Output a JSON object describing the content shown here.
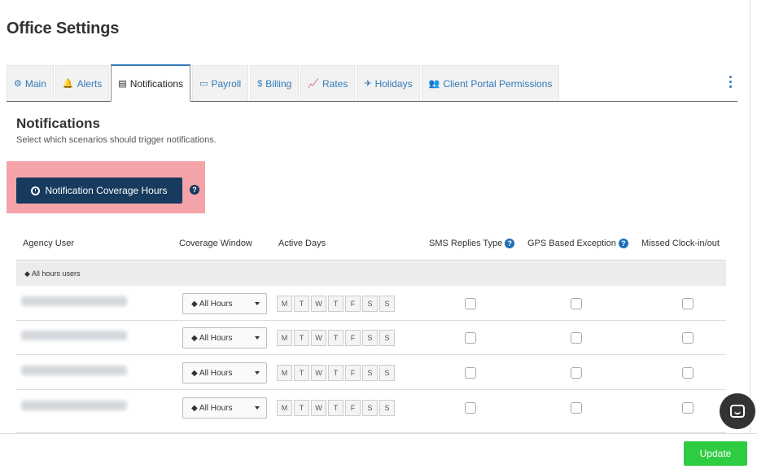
{
  "page": {
    "title": "Office Settings"
  },
  "tabs": [
    {
      "label": "Main",
      "icon": "gear-icon",
      "glyph": "⚙"
    },
    {
      "label": "Alerts",
      "icon": "bell-icon",
      "glyph": "🔔"
    },
    {
      "label": "Notifications",
      "icon": "file-icon",
      "glyph": "▤",
      "active": true
    },
    {
      "label": "Payroll",
      "icon": "payroll-icon",
      "glyph": "▭"
    },
    {
      "label": "Billing",
      "icon": "dollar-icon",
      "glyph": "$"
    },
    {
      "label": "Rates",
      "icon": "chart-icon",
      "glyph": "📈"
    },
    {
      "label": "Holidays",
      "icon": "plane-icon",
      "glyph": "✈"
    },
    {
      "label": "Client Portal Permissions",
      "icon": "users-icon",
      "glyph": "👥"
    }
  ],
  "section": {
    "title": "Notifications",
    "description": "Select which scenarios should trigger notifications."
  },
  "coverage_button": {
    "label": "Notification Coverage Hours"
  },
  "help_glyph": "?",
  "table": {
    "headers": {
      "agency_user": "Agency User",
      "coverage_window": "Coverage Window",
      "active_days": "Active Days",
      "sms_replies": "SMS Replies Type",
      "gps_exception": "GPS Based Exception",
      "missed_clock": "Missed Clock-in/out"
    },
    "group_label": "◆ All hours users",
    "coverage_option": "◆ All Hours",
    "days": [
      "M",
      "T",
      "W",
      "T",
      "F",
      "S",
      "S"
    ],
    "row_count": 4
  },
  "footer": {
    "update_label": "Update"
  },
  "colors": {
    "accent": "#337ab7",
    "primary_button": "#173a5e",
    "update_button": "#2ecc40",
    "highlight": "#f4a3a8"
  }
}
